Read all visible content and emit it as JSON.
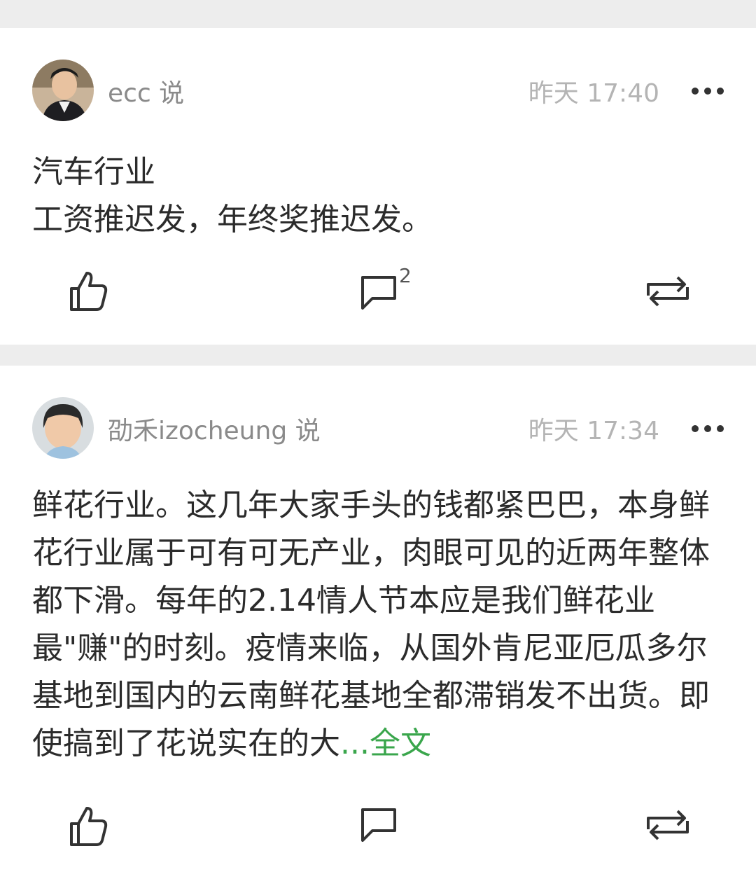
{
  "posts": [
    {
      "author": "ecc 说",
      "time": "昨天 17:40",
      "lines": [
        "汽车行业",
        "工资推迟发，年终奖推迟发。"
      ],
      "comment_count": "2",
      "avatar_icon": "user-avatar-icon"
    },
    {
      "author": "劭禾izocheung 说",
      "time": "昨天 17:34",
      "text": "鲜花行业。这几年大家手头的钱都紧巴巴，本身鲜花行业属于可有可无产业，肉眼可见的近两年整体都下滑。每年的2.14情人节本应是我们鲜花业最\"赚\"的时刻。疫情来临，从国外肯尼亚厄瓜多尔基地到国内的云南鲜花基地全都滞销发不出货。即使搞到了花说实在的大",
      "more_label": "...全文",
      "avatar_icon": "user-avatar-icon"
    }
  ],
  "icons": {
    "like": "thumbs-up-icon",
    "comment": "comment-bubble-icon",
    "repost": "repost-icon",
    "more": "more-dots-icon"
  },
  "colors": {
    "accent_green": "#3aa64c",
    "separator_gray": "#ededed"
  }
}
